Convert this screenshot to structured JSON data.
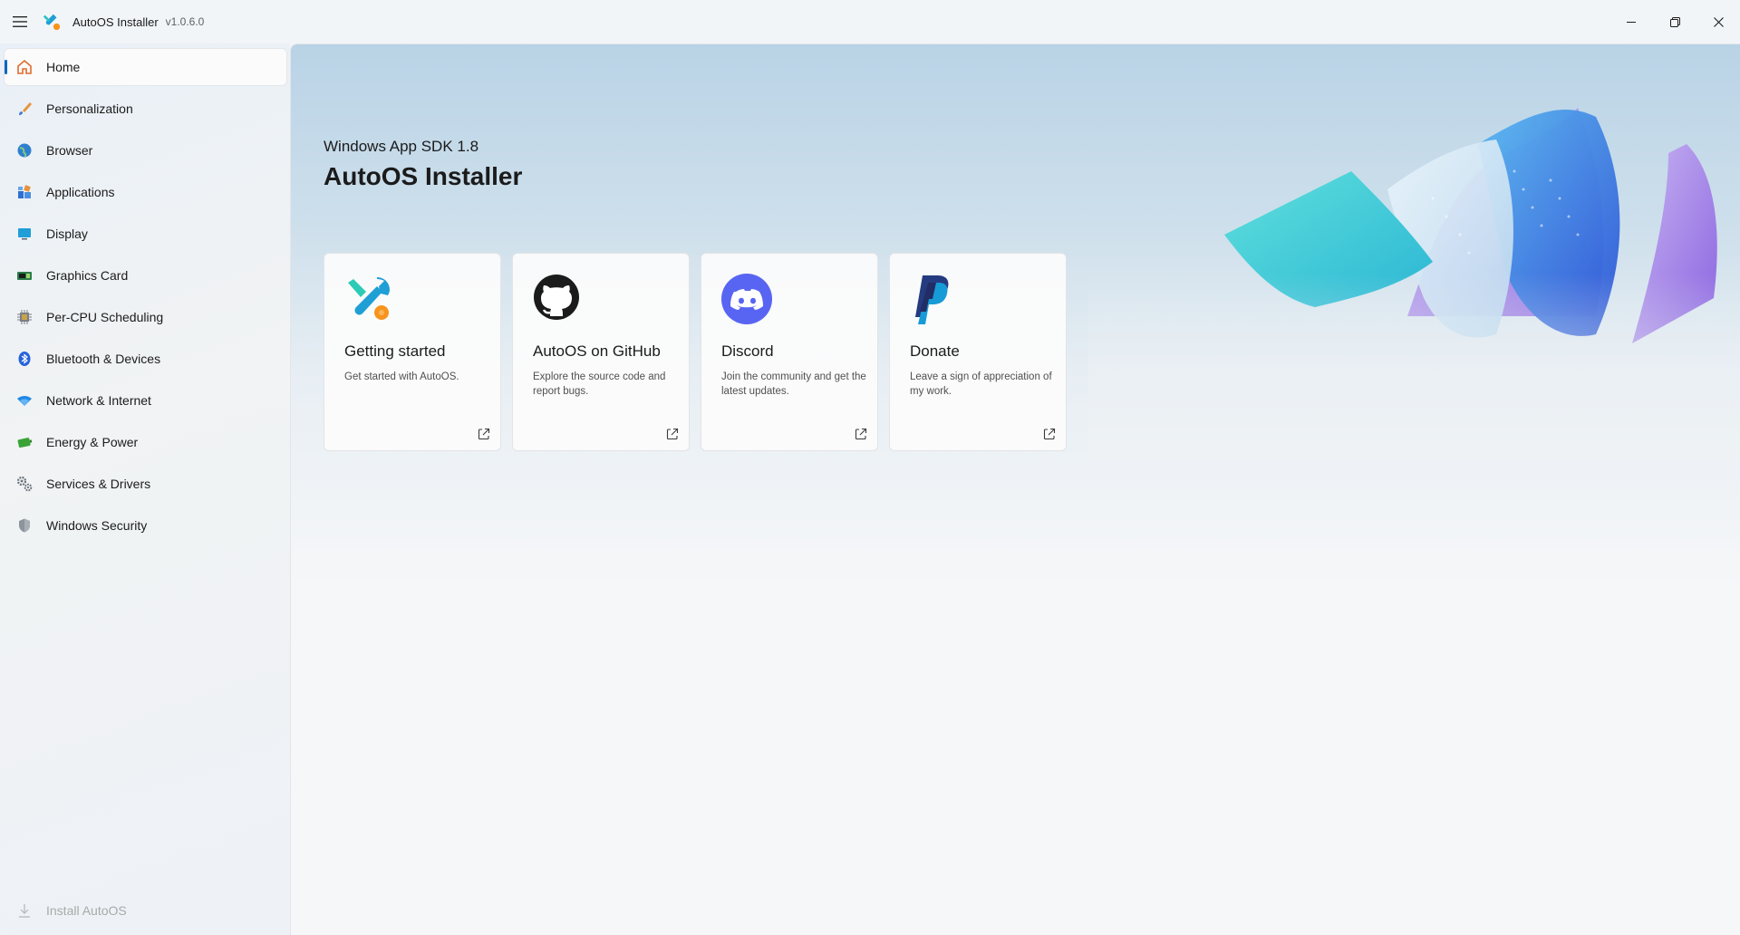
{
  "window": {
    "title": "AutoOS Installer",
    "version": "v1.0.6.0",
    "minimize_icon": "minimize-icon",
    "maximize_icon": "restore-icon",
    "close_icon": "close-icon"
  },
  "sidebar": {
    "items": [
      {
        "label": "Home",
        "icon": "home-icon",
        "active": true
      },
      {
        "label": "Personalization",
        "icon": "brush-icon"
      },
      {
        "label": "Browser",
        "icon": "globe-icon"
      },
      {
        "label": "Applications",
        "icon": "apps-icon"
      },
      {
        "label": "Display",
        "icon": "monitor-icon"
      },
      {
        "label": "Graphics Card",
        "icon": "gpu-icon"
      },
      {
        "label": "Per-CPU Scheduling",
        "icon": "cpu-icon"
      },
      {
        "label": "Bluetooth & Devices",
        "icon": "bluetooth-icon"
      },
      {
        "label": "Network & Internet",
        "icon": "wifi-icon"
      },
      {
        "label": "Energy & Power",
        "icon": "battery-icon"
      },
      {
        "label": "Services & Drivers",
        "icon": "services-icon"
      },
      {
        "label": "Windows Security",
        "icon": "shield-icon"
      }
    ],
    "footer": {
      "label": "Install AutoOS",
      "icon": "download-icon"
    }
  },
  "hero": {
    "subtitle": "Windows App SDK 1.8",
    "title": "AutoOS Installer"
  },
  "cards": [
    {
      "title": "Getting started",
      "description": "Get started with AutoOS.",
      "icon": "wrench-icon"
    },
    {
      "title": "AutoOS on GitHub",
      "description": "Explore the source code and report bugs.",
      "icon": "github-icon"
    },
    {
      "title": "Discord",
      "description": "Join the community and get the latest updates.",
      "icon": "discord-icon"
    },
    {
      "title": "Donate",
      "description": "Leave a sign of appreciation of my work.",
      "icon": "paypal-icon"
    }
  ],
  "colors": {
    "accent": "#0067c0",
    "discord": "#5865f2",
    "paypal_dark": "#253b80",
    "paypal_light": "#179bd7"
  }
}
